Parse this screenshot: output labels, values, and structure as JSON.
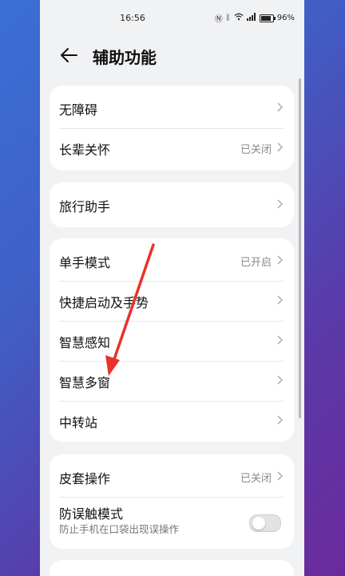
{
  "status_bar": {
    "time": "16:56",
    "battery": "96%"
  },
  "header": {
    "title": "辅助功能"
  },
  "groups": [
    {
      "items": [
        {
          "label": "无障碍",
          "value": ""
        },
        {
          "label": "长辈关怀",
          "value": "已关闭"
        }
      ]
    },
    {
      "items": [
        {
          "label": "旅行助手",
          "value": ""
        }
      ]
    },
    {
      "items": [
        {
          "label": "单手模式",
          "value": "已开启"
        },
        {
          "label": "快捷启动及手势",
          "value": ""
        },
        {
          "label": "智慧感知",
          "value": ""
        },
        {
          "label": "智慧多窗",
          "value": ""
        },
        {
          "label": "中转站",
          "value": ""
        }
      ]
    },
    {
      "items": [
        {
          "label": "皮套操作",
          "value": "已关闭"
        },
        {
          "label": "防误触模式",
          "subtitle": "防止手机在口袋出现误操作",
          "toggle_on": false
        }
      ]
    }
  ],
  "annotation": {
    "arrow_color": "#e8332a"
  }
}
